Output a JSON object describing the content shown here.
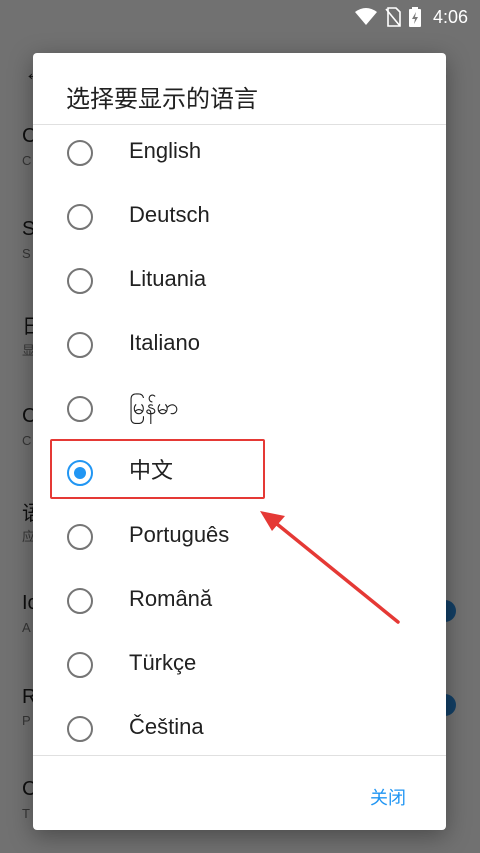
{
  "status_bar": {
    "time": "4:06"
  },
  "background": {
    "rows": [
      {
        "label": "C",
        "sub": "C"
      },
      {
        "label": "S",
        "sub": "S"
      },
      {
        "label": "日",
        "sub": "显"
      },
      {
        "label": "C",
        "sub": "C"
      },
      {
        "label": "语",
        "sub": "应"
      },
      {
        "label": "Ic",
        "sub": "A"
      },
      {
        "label": "R",
        "sub": "P"
      },
      {
        "label": "C",
        "sub": "T"
      }
    ]
  },
  "dialog": {
    "title": "选择要显示的语言",
    "options": [
      {
        "label": "English",
        "selected": false
      },
      {
        "label": "Deutsch",
        "selected": false
      },
      {
        "label": "Lituania",
        "selected": false
      },
      {
        "label": "Italiano",
        "selected": false
      },
      {
        "label": "မြန်မာ",
        "selected": false
      },
      {
        "label": "中文",
        "selected": true
      },
      {
        "label": "Português",
        "selected": false
      },
      {
        "label": "Română",
        "selected": false
      },
      {
        "label": "Türkçe",
        "selected": false
      },
      {
        "label": "Čeština",
        "selected": false
      }
    ],
    "close_label": "关闭"
  },
  "colors": {
    "accent": "#2196f3",
    "annotation": "#e53935"
  }
}
